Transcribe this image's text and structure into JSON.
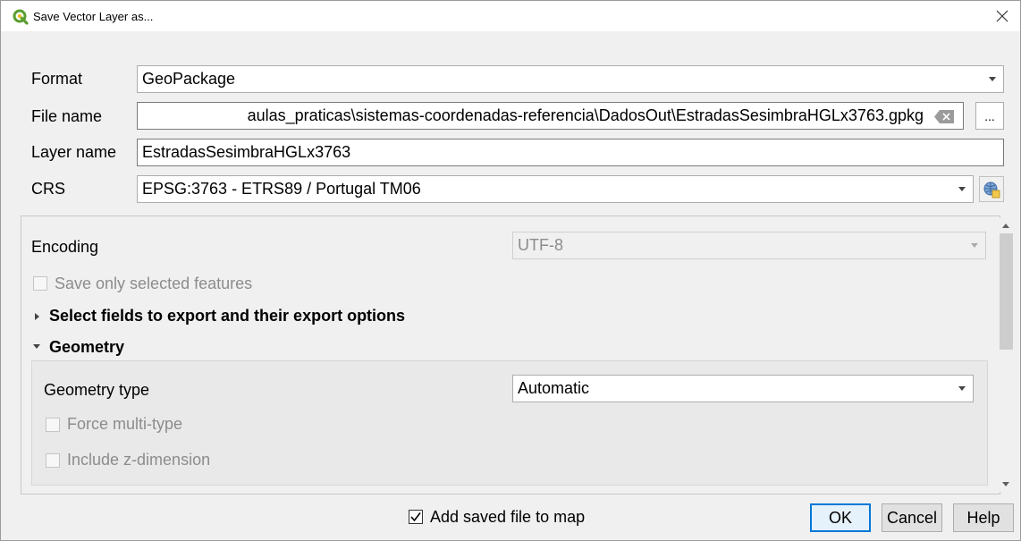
{
  "window": {
    "title": "Save Vector Layer as...",
    "app_icon": "qgis-icon",
    "close_icon": "close-icon"
  },
  "form": {
    "format_label": "Format",
    "format_value": "GeoPackage",
    "filename_label": "File name",
    "filename_value": "aulas_praticas\\sistemas-coordenadas-referencia\\DadosOut\\EstradasSesimbraHGLx3763.gpkg",
    "browse_label": "...",
    "layername_label": "Layer name",
    "layername_value": "EstradasSesimbraHGLx3763",
    "crs_label": "CRS",
    "crs_value": "EPSG:3763 - ETRS89 / Portugal TM06"
  },
  "options": {
    "encoding_label": "Encoding",
    "encoding_value": "UTF-8",
    "save_selected_label": "Save only selected features",
    "fields_section_label": "Select fields to export and their export options",
    "geometry_section_label": "Geometry",
    "geometry_type_label": "Geometry type",
    "geometry_type_value": "Automatic",
    "force_multi_label": "Force multi-type",
    "include_z_label": "Include z-dimension"
  },
  "footer": {
    "add_to_map_label": "Add saved file to map",
    "ok_label": "OK",
    "cancel_label": "Cancel",
    "help_label": "Help"
  }
}
